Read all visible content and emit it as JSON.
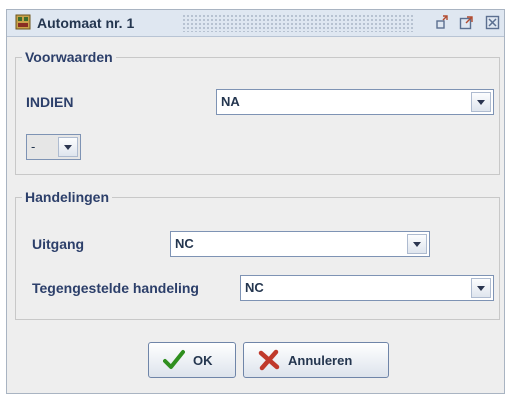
{
  "window": {
    "title": "Automaat nr. 1"
  },
  "conditions": {
    "legend": "Voorwaarden",
    "indien_label": "INDIEN",
    "indien_value": "NA",
    "operator_value": "-"
  },
  "actions": {
    "legend": "Handelingen",
    "output_label": "Uitgang",
    "output_value": "NC",
    "opposite_label": "Tegengestelde handeling",
    "opposite_value": "NC"
  },
  "buttons": {
    "ok": "OK",
    "cancel": "Annuleren"
  }
}
